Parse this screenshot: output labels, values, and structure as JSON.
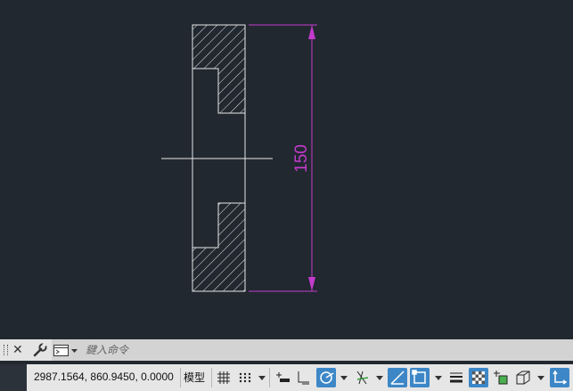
{
  "drawing": {
    "dimension_text": "150",
    "colors": {
      "background": "#212830",
      "geometry": "#e8e8e8",
      "dimension": "#c33bcc"
    }
  },
  "command_line": {
    "placeholder": "鍵入命令",
    "icons": [
      "grip-handle",
      "close-icon",
      "wrench-icon",
      "command-prompt-icon",
      "chevron-down-icon"
    ]
  },
  "status_bar": {
    "coordinates": "2987.1564, 860.9450, 0.0000",
    "model_tab": "模型",
    "icons": [
      "grid-icon",
      "snap-icon",
      "infer-constraints-icon",
      "dynamic-input-icon",
      "ortho-icon",
      "polar-tracking-icon",
      "isodraft-icon",
      "object-snap-tracking-icon",
      "object-snap-icon",
      "lineweight-icon",
      "transparency-icon",
      "selection-cycling-icon",
      "3d-object-snap-icon",
      "ucs-icon"
    ],
    "accent_color": "#3d87c7"
  }
}
